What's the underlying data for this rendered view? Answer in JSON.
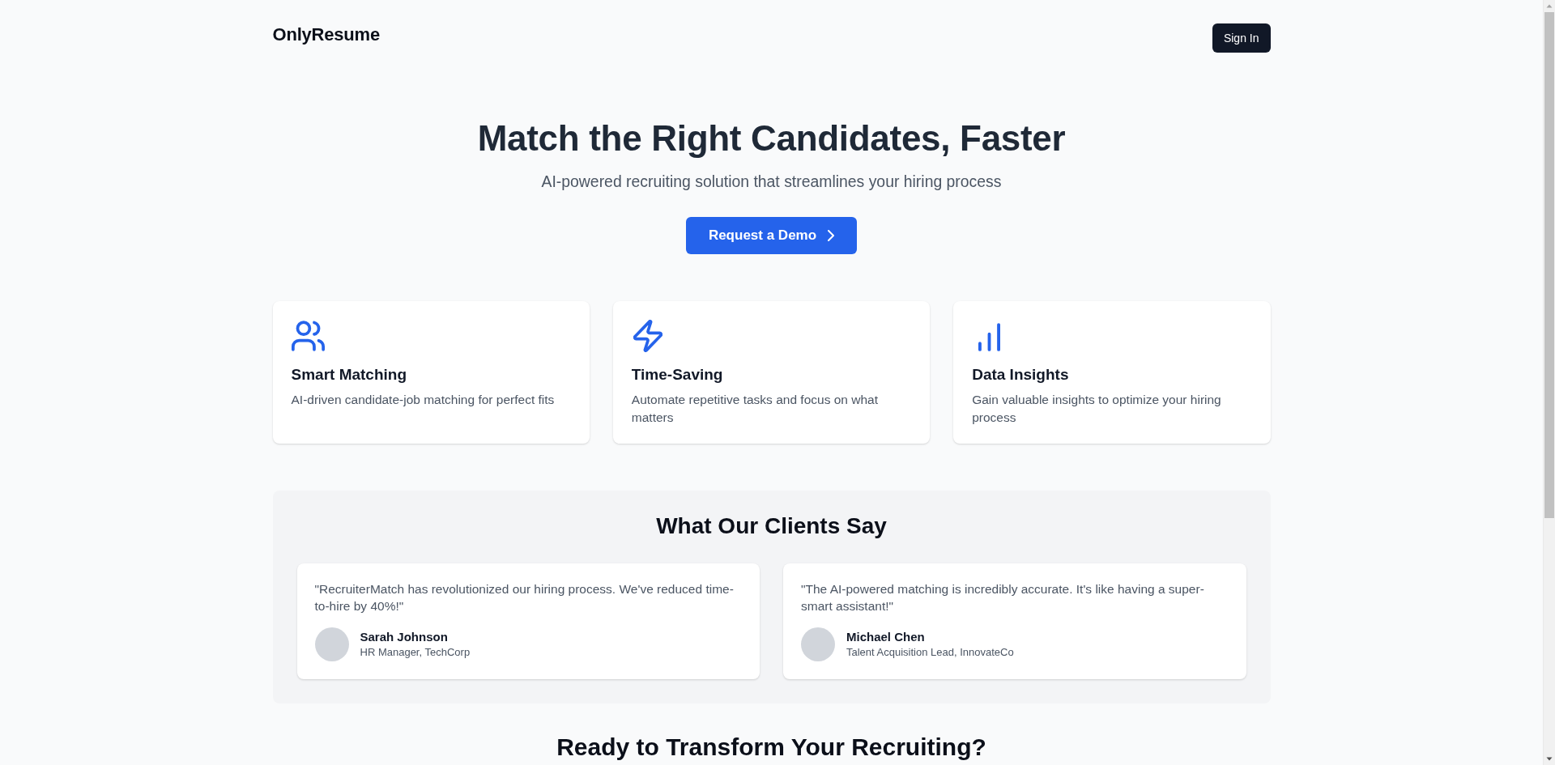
{
  "header": {
    "logo": "OnlyResume",
    "sign_in": "Sign In"
  },
  "hero": {
    "title": "Match the Right Candidates, Faster",
    "subtitle": "AI-powered recruiting solution that streamlines your hiring process",
    "cta": "Request a Demo"
  },
  "features": [
    {
      "title": "Smart Matching",
      "description": "AI-driven candidate-job matching for perfect fits"
    },
    {
      "title": "Time-Saving",
      "description": "Automate repetitive tasks and focus on what matters"
    },
    {
      "title": "Data Insights",
      "description": "Gain valuable insights to optimize your hiring process"
    }
  ],
  "testimonials": {
    "title": "What Our Clients Say",
    "items": [
      {
        "quote": "\"RecruiterMatch has revolutionized our hiring process. We've reduced time-to-hire by 40%!\"",
        "name": "Sarah Johnson",
        "role": "HR Manager, TechCorp"
      },
      {
        "quote": "\"The AI-powered matching is incredibly accurate. It's like having a super-smart assistant!\"",
        "name": "Michael Chen",
        "role": "Talent Acquisition Lead, InnovateCo"
      }
    ]
  },
  "closing": {
    "title": "Ready to Transform Your Recruiting?"
  }
}
